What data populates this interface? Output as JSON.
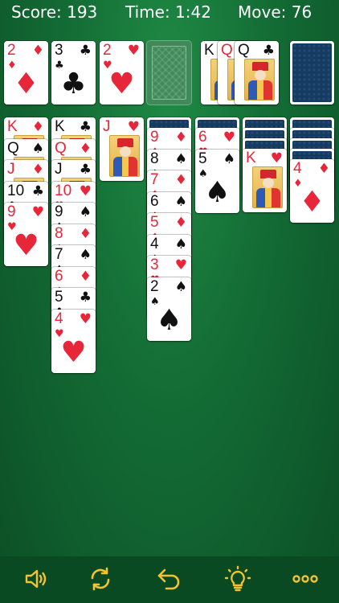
{
  "status": {
    "score_text": "Score: 193",
    "time_text": "Time: 1:42",
    "move_text": "Move: 76"
  },
  "colors": {
    "table_green": "#136b34",
    "red_suit": "#e8263a",
    "black_suit": "#111111",
    "toolbar_icon": "#f2c230",
    "card_back": "#153b63"
  },
  "foundations": [
    {
      "rank": "2",
      "suit": "♦",
      "color": "red"
    },
    {
      "rank": "3",
      "suit": "♣",
      "color": "black"
    },
    {
      "rank": "2",
      "suit": "♥",
      "color": "red"
    }
  ],
  "waste": [
    {
      "rank": "K",
      "suit": "♠",
      "color": "black"
    },
    {
      "rank": "Q",
      "suit": "♥",
      "color": "red"
    },
    {
      "rank": "Q",
      "suit": "♣",
      "color": "black"
    }
  ],
  "tableau": [
    {
      "hidden_count": 0,
      "cards": [
        {
          "rank": "K",
          "suit": "♦",
          "color": "red"
        },
        {
          "rank": "Q",
          "suit": "♠",
          "color": "black"
        },
        {
          "rank": "J",
          "suit": "♦",
          "color": "red"
        },
        {
          "rank": "10",
          "suit": "♣",
          "color": "black"
        },
        {
          "rank": "9",
          "suit": "♥",
          "color": "red"
        }
      ]
    },
    {
      "hidden_count": 0,
      "cards": [
        {
          "rank": "K",
          "suit": "♣",
          "color": "black"
        },
        {
          "rank": "Q",
          "suit": "♦",
          "color": "red"
        },
        {
          "rank": "J",
          "suit": "♣",
          "color": "black"
        },
        {
          "rank": "10",
          "suit": "♥",
          "color": "red"
        },
        {
          "rank": "9",
          "suit": "♠",
          "color": "black"
        },
        {
          "rank": "8",
          "suit": "♦",
          "color": "red"
        },
        {
          "rank": "7",
          "suit": "♠",
          "color": "black"
        },
        {
          "rank": "6",
          "suit": "♦",
          "color": "red"
        },
        {
          "rank": "5",
          "suit": "♣",
          "color": "black"
        },
        {
          "rank": "4",
          "suit": "♥",
          "color": "red"
        }
      ]
    },
    {
      "hidden_count": 0,
      "cards": [
        {
          "rank": "J",
          "suit": "♥",
          "color": "red"
        }
      ]
    },
    {
      "hidden_count": 1,
      "cards": [
        {
          "rank": "9",
          "suit": "♦",
          "color": "red"
        },
        {
          "rank": "8",
          "suit": "♠",
          "color": "black"
        },
        {
          "rank": "7",
          "suit": "♦",
          "color": "red"
        },
        {
          "rank": "6",
          "suit": "♠",
          "color": "black"
        },
        {
          "rank": "5",
          "suit": "♦",
          "color": "red"
        },
        {
          "rank": "4",
          "suit": "♠",
          "color": "black"
        },
        {
          "rank": "3",
          "suit": "♥",
          "color": "red"
        },
        {
          "rank": "2",
          "suit": "♠",
          "color": "black"
        }
      ]
    },
    {
      "hidden_count": 1,
      "cards": [
        {
          "rank": "6",
          "suit": "♥",
          "color": "red"
        },
        {
          "rank": "5",
          "suit": "♠",
          "color": "black"
        }
      ]
    },
    {
      "hidden_count": 3,
      "cards": [
        {
          "rank": "K",
          "suit": "♥",
          "color": "red"
        }
      ]
    },
    {
      "hidden_count": 4,
      "cards": [
        {
          "rank": "4",
          "suit": "♦",
          "color": "red"
        }
      ]
    }
  ],
  "toolbar": [
    {
      "name": "sound-button",
      "icon": "speaker-icon"
    },
    {
      "name": "new-game-button",
      "icon": "refresh-icon"
    },
    {
      "name": "undo-button",
      "icon": "undo-icon"
    },
    {
      "name": "hint-button",
      "icon": "lightbulb-icon"
    },
    {
      "name": "more-button",
      "icon": "more-dots-icon"
    }
  ]
}
